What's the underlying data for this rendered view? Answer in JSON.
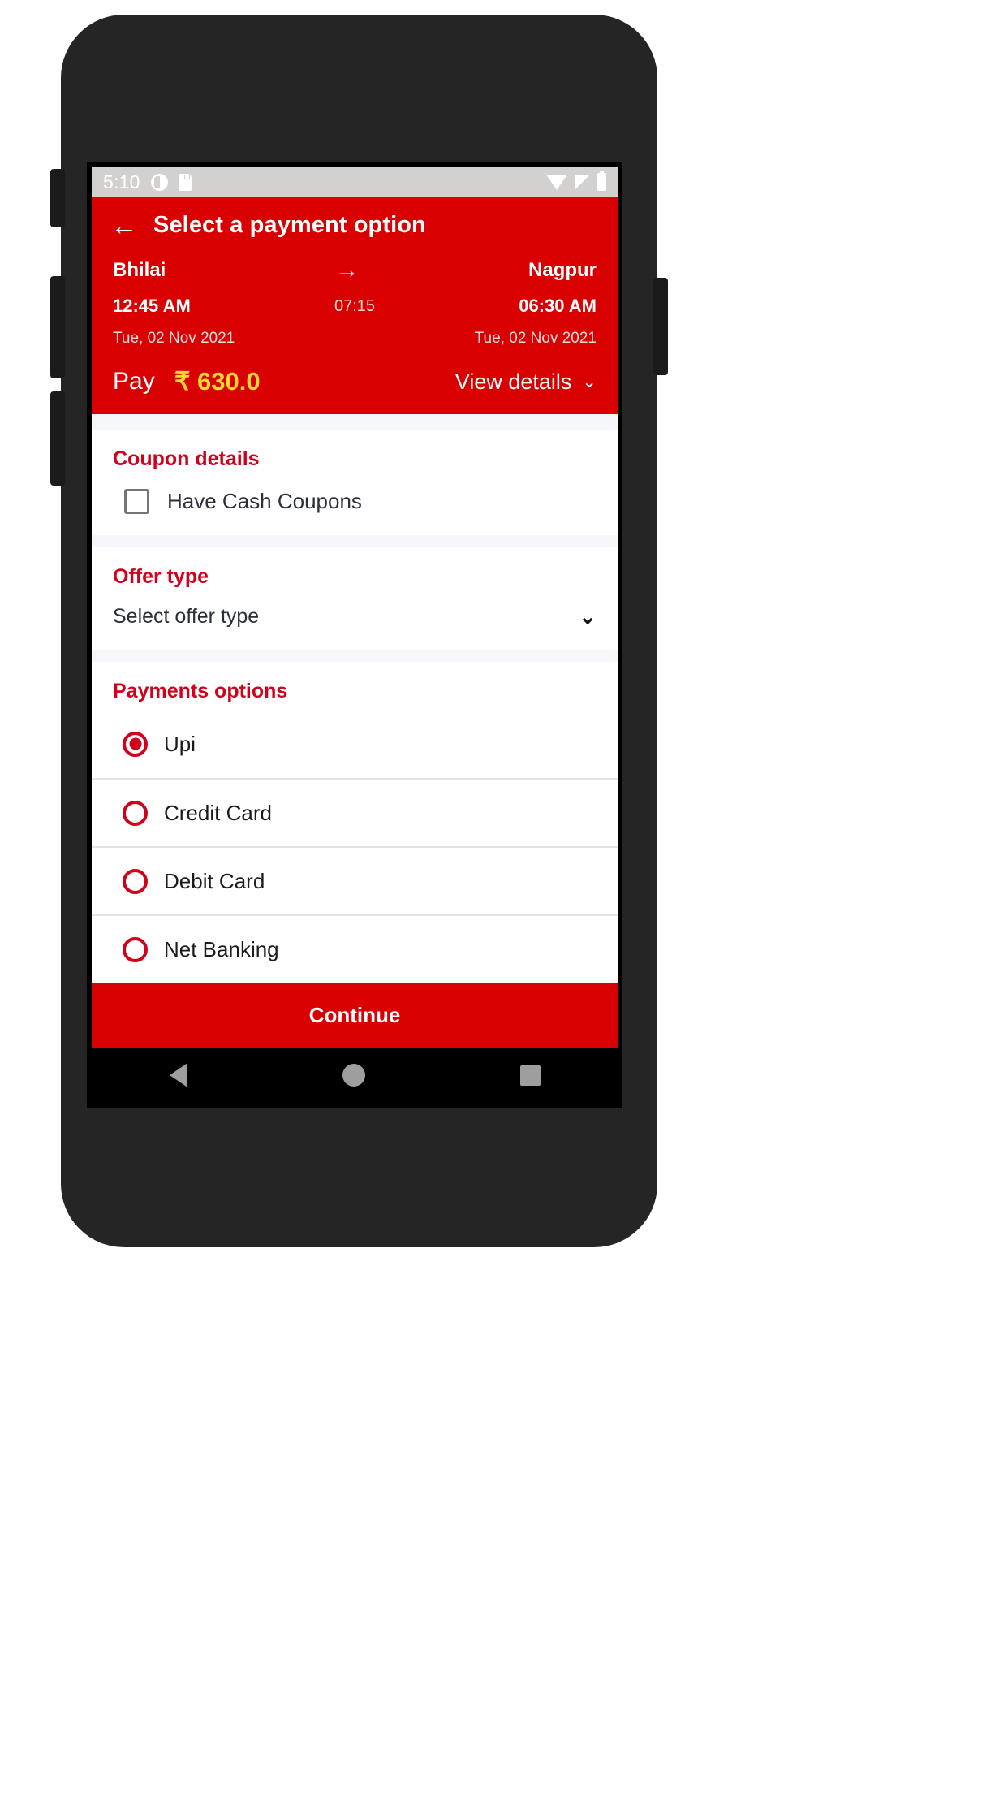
{
  "statusbar": {
    "time": "5:10",
    "left_icons": [
      "do-not-disturb-icon",
      "sd-card-icon"
    ],
    "right_icons": [
      "wifi-icon",
      "signal-icon",
      "battery-icon"
    ]
  },
  "header": {
    "back_label": "←",
    "title": "Select a payment option",
    "route": {
      "origin_city": "Bhilai",
      "destination_city": "Nagpur",
      "arrow": "→",
      "departure_time": "12:45 AM",
      "duration": "07:15",
      "arrival_time": "06:30 AM",
      "departure_date": "Tue, 02 Nov 2021",
      "arrival_date": "Tue, 02 Nov 2021"
    },
    "pay_label": "Pay",
    "pay_amount": "₹ 630.0",
    "view_details_label": "View details",
    "view_details_chevron": "⌄"
  },
  "coupon": {
    "section_title": "Coupon details",
    "checkbox_label": "Have Cash Coupons",
    "checked": false
  },
  "offer": {
    "section_title": "Offer type",
    "selected_value": "Select offer type",
    "chevron": "⌄"
  },
  "payments": {
    "section_title": "Payments options",
    "options": [
      {
        "label": "Upi",
        "selected": true
      },
      {
        "label": "Credit Card",
        "selected": false
      },
      {
        "label": "Debit Card",
        "selected": false
      },
      {
        "label": "Net Banking",
        "selected": false
      }
    ]
  },
  "footer": {
    "continue_label": "Continue"
  },
  "colors": {
    "brand_red": "#d80000",
    "section_red": "#d0021b",
    "amount_yellow": "#ffd72e",
    "statusbar_gray": "#d3d1d0",
    "page_bg": "#f5f7fa"
  }
}
